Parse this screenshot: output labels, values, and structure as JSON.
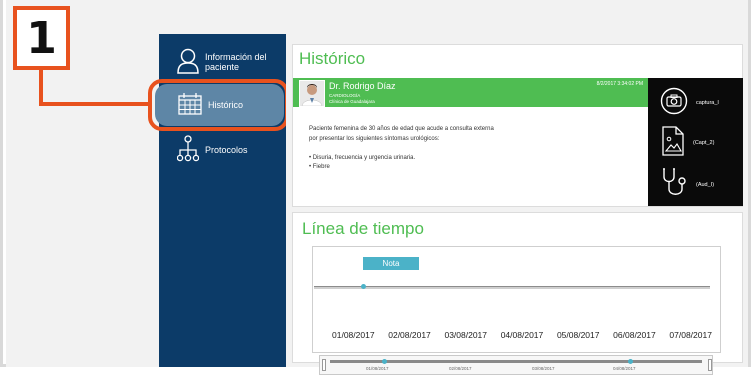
{
  "callout": {
    "number": "1",
    "color": "#e8521e"
  },
  "sidebar": {
    "bg_color": "#0c3b68",
    "items": [
      {
        "icon": "person-outline-icon",
        "label_line1": "Información del",
        "label_line2": "paciente"
      },
      {
        "icon": "calendar-grid-icon",
        "label": "Histórico",
        "active": true
      },
      {
        "icon": "org-chart-icon",
        "label": "Protocolos"
      }
    ]
  },
  "history": {
    "title": "Histórico",
    "doctor": {
      "name": "Dr. Rodrigo Díaz",
      "specialty": "CARDIOLOGÍA",
      "clinic": "Clínica de Guadalajara",
      "datetime": "8/2/2017 3:34:02 PM"
    },
    "note_lines": [
      "Paciente femenina de 30 años de edad que acude a consulta externa",
      "por presentar los siguientes síntomas urológicos:",
      "",
      "• Disuria, frecuencia y urgencia urinaria.",
      "• Fiebre"
    ],
    "attachments": [
      {
        "icon": "camera-icon",
        "label": "captura_I"
      },
      {
        "icon": "image-file-icon",
        "label": "(Capt_2)"
      },
      {
        "icon": "stethoscope-icon",
        "label": "(Aud_I)"
      }
    ]
  },
  "timeline": {
    "title": "Línea de tiempo",
    "event_label": "Nota",
    "dates": [
      "01/08/2017",
      "02/08/2017",
      "03/08/2017",
      "04/08/2017",
      "05/08/2017",
      "06/08/2017",
      "07/08/2017"
    ],
    "navigator_dates": [
      "01/08/2017",
      "02/08/2017",
      "03/08/2017",
      "04/08/2017"
    ],
    "accent_color": "#4bb2c8"
  },
  "colors": {
    "green": "#4fbd52",
    "highlight": "#5e86a6"
  }
}
